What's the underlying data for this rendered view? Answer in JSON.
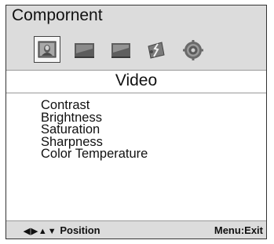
{
  "window": {
    "title": "Compornent"
  },
  "tabs": [
    {
      "name": "picture-icon",
      "selected": true
    },
    {
      "name": "screen-icon",
      "selected": false
    },
    {
      "name": "display-icon",
      "selected": false
    },
    {
      "name": "tools-icon",
      "selected": false
    },
    {
      "name": "settings-icon",
      "selected": false
    }
  ],
  "section": {
    "title": "Video"
  },
  "menu": {
    "items": [
      {
        "label": "Contrast"
      },
      {
        "label": "Brightness"
      },
      {
        "label": "Saturation"
      },
      {
        "label": "Sharpness"
      },
      {
        "label": "Color Temperature"
      }
    ]
  },
  "footer": {
    "nav_glyph": "◀▶▲▼",
    "nav_label": "Position",
    "exit_label": "Menu:Exit"
  }
}
